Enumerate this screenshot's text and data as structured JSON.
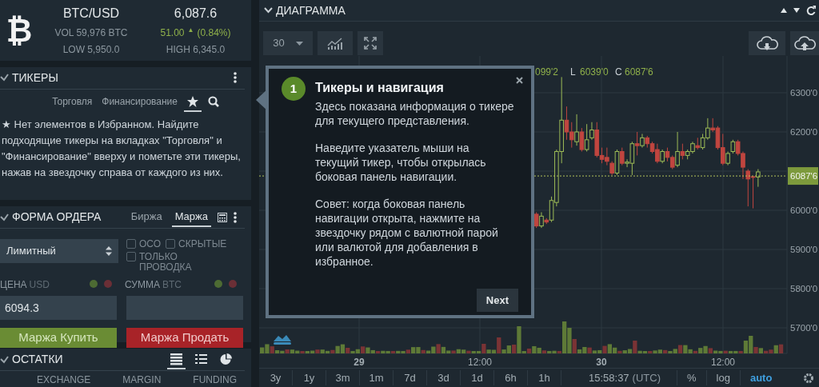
{
  "ticker": {
    "logo": "₿",
    "symbol": "BTC/USD",
    "price": "6,087.6",
    "volume": "VOL 59,976 BTC",
    "change": "51.00",
    "change_arrow": "▲",
    "change_pct": "(0.84%)",
    "low": "LOW 5,950.0",
    "high": "HIGH 6,345.0"
  },
  "tickers_panel": {
    "title": "ТИКЕРЫ",
    "tabs": [
      {
        "kind": "text",
        "label": "Торговля",
        "selected": false
      },
      {
        "kind": "text",
        "label": "Финансирование",
        "selected": false
      },
      {
        "kind": "star",
        "selected": true
      },
      {
        "kind": "search",
        "selected": false
      }
    ],
    "message": "★ Нет элементов в Избранном. Найдите подходящие тикеры на вкладках \"Торговля\" и \"Финансирование\" вверху и пометьте эти тикеры, нажав на звездочку справа от каждого из них."
  },
  "order_form": {
    "title": "ФОРМА ОРДЕРА",
    "tabs": [
      {
        "label": "Биржа",
        "selected": false
      },
      {
        "label": "Маржа",
        "selected": true
      }
    ],
    "order_type": "Лимитный",
    "options": [
      {
        "label": "ОСО",
        "checked": false
      },
      {
        "label": "СКРЫТЫЕ",
        "checked": false
      },
      {
        "label": "ТОЛЬКО ПРОВОДКА",
        "checked": false
      }
    ],
    "price": {
      "label": "ЦЕНА",
      "unit": "USD",
      "value": "6094.3"
    },
    "amount": {
      "label": "СУММА",
      "unit": "BTC"
    },
    "buttons": [
      {
        "kind": "buy",
        "label": "Маржа Купить"
      },
      {
        "kind": "sell",
        "label": "Маржа Продать"
      }
    ]
  },
  "balances": {
    "title": "ОСТАТКИ",
    "views": [
      {
        "kind": "table",
        "selected": true
      },
      {
        "kind": "list",
        "selected": false
      },
      {
        "kind": "pie",
        "selected": false
      }
    ],
    "columns": [
      "EXCHANGE",
      "MARGIN",
      "FUNDING"
    ]
  },
  "chart": {
    "title": "ДИАГРАММА",
    "interval": "30",
    "legend": [
      {
        "kind": "value",
        "text": "099'2"
      },
      {
        "kind": "key",
        "text": "L"
      },
      {
        "kind": "value",
        "text": "6039'0"
      },
      {
        "kind": "key",
        "text": "C"
      },
      {
        "kind": "value",
        "text": "6087'6"
      }
    ],
    "y_labels": [
      "6300'0",
      "6200'0",
      "6000'0",
      "5900'0",
      "5800'0",
      "5700'0"
    ],
    "last_price": "6087'6",
    "x_labels": [
      "29",
      "12:00",
      "30",
      "12:00"
    ],
    "ranges": [
      "3y",
      "1y",
      "3m",
      "1m",
      "7d",
      "3d",
      "1d",
      "6h",
      "1h"
    ],
    "clock": "15:58:37",
    "timezone": "(UTC)",
    "scale_options": [
      {
        "label": "%",
        "selected": false
      },
      {
        "label": "log",
        "selected": false
      },
      {
        "label": "auto",
        "selected": true
      }
    ]
  },
  "tour": {
    "step": "1",
    "title": "Тикеры и навигация",
    "paragraphs": [
      "Здесь показана информация о тикере для текущего представления.",
      "Наведите указатель мыши на текущий тикер, чтобы открылась боковая панель навигации.",
      "Совет: когда боковая панель навигации открыта, нажмите на звездочку рядом с валютной парой или валютой для добавления в избранное."
    ],
    "button": "Next"
  }
}
